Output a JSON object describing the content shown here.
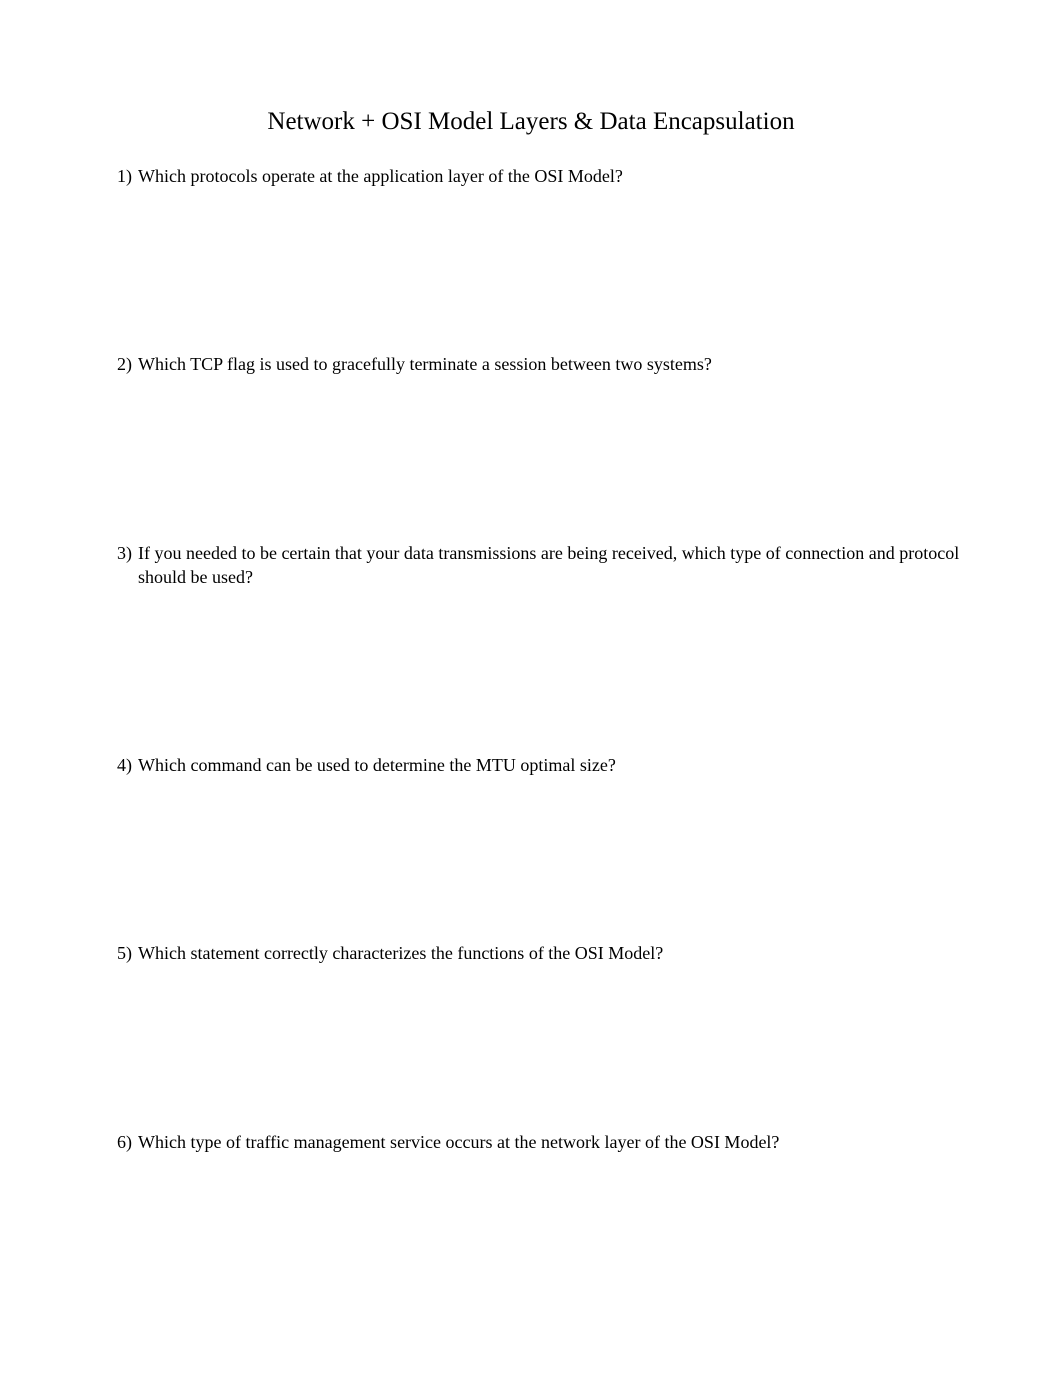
{
  "title": "Network + OSI Model Layers & Data Encapsulation",
  "questions": [
    {
      "number": "1)",
      "text": "Which protocols operate at the application layer of the OSI Model?"
    },
    {
      "number": "2)",
      "text": "Which TCP flag is used to gracefully terminate a session between two systems?"
    },
    {
      "number": "3)",
      "text": "If you needed to be certain that your data transmissions are being received, which type of connection and protocol should be used?"
    },
    {
      "number": "4)",
      "text": "Which command can be used to determine the MTU optimal size?"
    },
    {
      "number": "5)",
      "text": "Which statement correctly characterizes the functions of the OSI Model?"
    },
    {
      "number": "6)",
      "text": "Which type of traffic management service occurs at the network layer of the OSI Model?"
    }
  ]
}
